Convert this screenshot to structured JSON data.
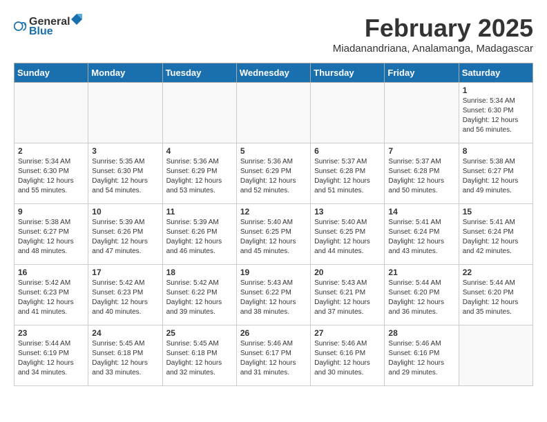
{
  "header": {
    "logo_line1": "General",
    "logo_line2": "Blue",
    "month_year": "February 2025",
    "location": "Miadanandriana, Analamanga, Madagascar"
  },
  "days_of_week": [
    "Sunday",
    "Monday",
    "Tuesday",
    "Wednesday",
    "Thursday",
    "Friday",
    "Saturday"
  ],
  "weeks": [
    [
      {
        "num": "",
        "info": ""
      },
      {
        "num": "",
        "info": ""
      },
      {
        "num": "",
        "info": ""
      },
      {
        "num": "",
        "info": ""
      },
      {
        "num": "",
        "info": ""
      },
      {
        "num": "",
        "info": ""
      },
      {
        "num": "1",
        "info": "Sunrise: 5:34 AM\nSunset: 6:30 PM\nDaylight: 12 hours\nand 56 minutes."
      }
    ],
    [
      {
        "num": "2",
        "info": "Sunrise: 5:34 AM\nSunset: 6:30 PM\nDaylight: 12 hours\nand 55 minutes."
      },
      {
        "num": "3",
        "info": "Sunrise: 5:35 AM\nSunset: 6:30 PM\nDaylight: 12 hours\nand 54 minutes."
      },
      {
        "num": "4",
        "info": "Sunrise: 5:36 AM\nSunset: 6:29 PM\nDaylight: 12 hours\nand 53 minutes."
      },
      {
        "num": "5",
        "info": "Sunrise: 5:36 AM\nSunset: 6:29 PM\nDaylight: 12 hours\nand 52 minutes."
      },
      {
        "num": "6",
        "info": "Sunrise: 5:37 AM\nSunset: 6:28 PM\nDaylight: 12 hours\nand 51 minutes."
      },
      {
        "num": "7",
        "info": "Sunrise: 5:37 AM\nSunset: 6:28 PM\nDaylight: 12 hours\nand 50 minutes."
      },
      {
        "num": "8",
        "info": "Sunrise: 5:38 AM\nSunset: 6:27 PM\nDaylight: 12 hours\nand 49 minutes."
      }
    ],
    [
      {
        "num": "9",
        "info": "Sunrise: 5:38 AM\nSunset: 6:27 PM\nDaylight: 12 hours\nand 48 minutes."
      },
      {
        "num": "10",
        "info": "Sunrise: 5:39 AM\nSunset: 6:26 PM\nDaylight: 12 hours\nand 47 minutes."
      },
      {
        "num": "11",
        "info": "Sunrise: 5:39 AM\nSunset: 6:26 PM\nDaylight: 12 hours\nand 46 minutes."
      },
      {
        "num": "12",
        "info": "Sunrise: 5:40 AM\nSunset: 6:25 PM\nDaylight: 12 hours\nand 45 minutes."
      },
      {
        "num": "13",
        "info": "Sunrise: 5:40 AM\nSunset: 6:25 PM\nDaylight: 12 hours\nand 44 minutes."
      },
      {
        "num": "14",
        "info": "Sunrise: 5:41 AM\nSunset: 6:24 PM\nDaylight: 12 hours\nand 43 minutes."
      },
      {
        "num": "15",
        "info": "Sunrise: 5:41 AM\nSunset: 6:24 PM\nDaylight: 12 hours\nand 42 minutes."
      }
    ],
    [
      {
        "num": "16",
        "info": "Sunrise: 5:42 AM\nSunset: 6:23 PM\nDaylight: 12 hours\nand 41 minutes."
      },
      {
        "num": "17",
        "info": "Sunrise: 5:42 AM\nSunset: 6:23 PM\nDaylight: 12 hours\nand 40 minutes."
      },
      {
        "num": "18",
        "info": "Sunrise: 5:42 AM\nSunset: 6:22 PM\nDaylight: 12 hours\nand 39 minutes."
      },
      {
        "num": "19",
        "info": "Sunrise: 5:43 AM\nSunset: 6:22 PM\nDaylight: 12 hours\nand 38 minutes."
      },
      {
        "num": "20",
        "info": "Sunrise: 5:43 AM\nSunset: 6:21 PM\nDaylight: 12 hours\nand 37 minutes."
      },
      {
        "num": "21",
        "info": "Sunrise: 5:44 AM\nSunset: 6:20 PM\nDaylight: 12 hours\nand 36 minutes."
      },
      {
        "num": "22",
        "info": "Sunrise: 5:44 AM\nSunset: 6:20 PM\nDaylight: 12 hours\nand 35 minutes."
      }
    ],
    [
      {
        "num": "23",
        "info": "Sunrise: 5:44 AM\nSunset: 6:19 PM\nDaylight: 12 hours\nand 34 minutes."
      },
      {
        "num": "24",
        "info": "Sunrise: 5:45 AM\nSunset: 6:18 PM\nDaylight: 12 hours\nand 33 minutes."
      },
      {
        "num": "25",
        "info": "Sunrise: 5:45 AM\nSunset: 6:18 PM\nDaylight: 12 hours\nand 32 minutes."
      },
      {
        "num": "26",
        "info": "Sunrise: 5:46 AM\nSunset: 6:17 PM\nDaylight: 12 hours\nand 31 minutes."
      },
      {
        "num": "27",
        "info": "Sunrise: 5:46 AM\nSunset: 6:16 PM\nDaylight: 12 hours\nand 30 minutes."
      },
      {
        "num": "28",
        "info": "Sunrise: 5:46 AM\nSunset: 6:16 PM\nDaylight: 12 hours\nand 29 minutes."
      },
      {
        "num": "",
        "info": ""
      }
    ]
  ]
}
